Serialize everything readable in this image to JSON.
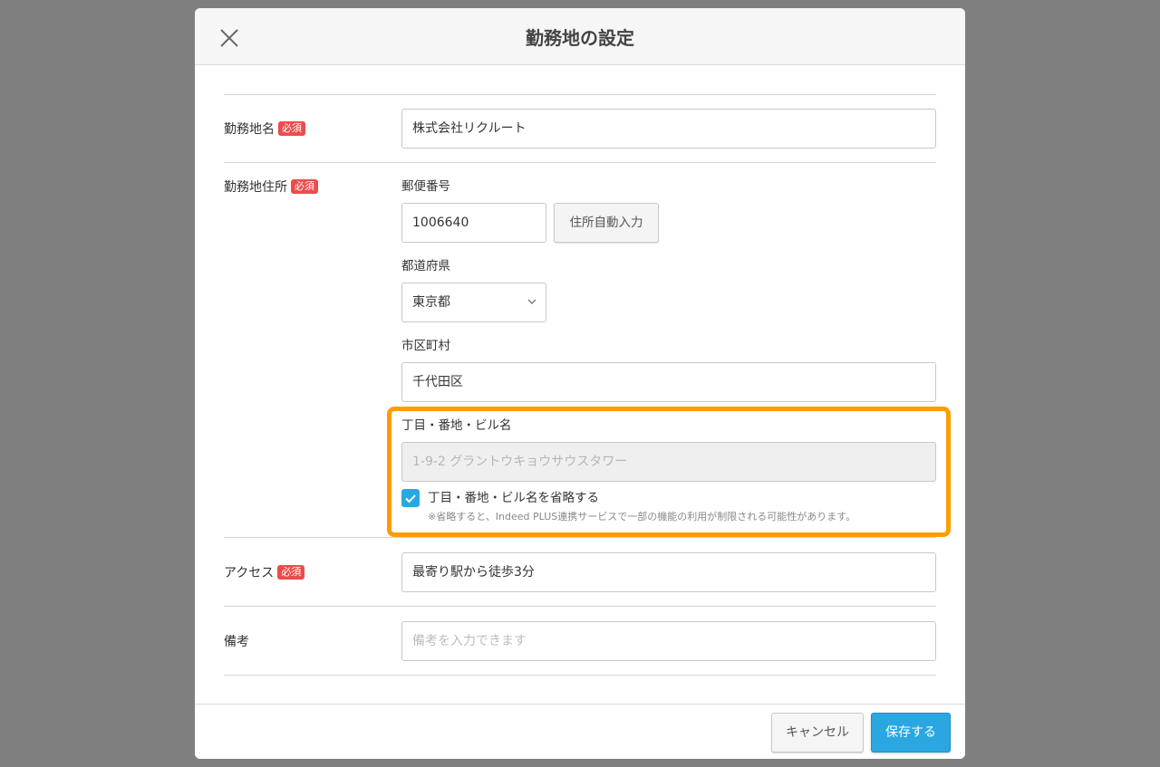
{
  "dialog": {
    "title": "勤務地の設定"
  },
  "fields": {
    "name": {
      "label": "勤務地名",
      "required_badge": "必須",
      "value": "株式会社リクルート"
    },
    "address": {
      "label": "勤務地住所",
      "required_badge": "必須",
      "postal_label": "郵便番号",
      "postal_value": "1006640",
      "auto_fill_label": "住所自動入力",
      "prefecture_label": "都道府県",
      "prefecture_value": "東京都",
      "city_label": "市区町村",
      "city_value": "千代田区",
      "street_label": "丁目・番地・ビル名",
      "street_value": "1-9-2 グラントウキョウサウスタワー",
      "omit_checkbox_label": "丁目・番地・ビル名を省略する",
      "omit_checked": true,
      "omit_note": "※省略すると、Indeed PLUS連携サービスで一部の機能の利用が制限される可能性があります。"
    },
    "access": {
      "label": "アクセス",
      "required_badge": "必須",
      "value": "最寄り駅から徒歩3分"
    },
    "notes": {
      "label": "備考",
      "placeholder": "備考を入力できます"
    }
  },
  "footer": {
    "cancel_label": "キャンセル",
    "save_label": "保存する"
  },
  "colors": {
    "overlay": "#7f7f7f",
    "accent": "#2aa7e0",
    "required": "#ee4b4b",
    "highlight": "#ff9d00"
  }
}
